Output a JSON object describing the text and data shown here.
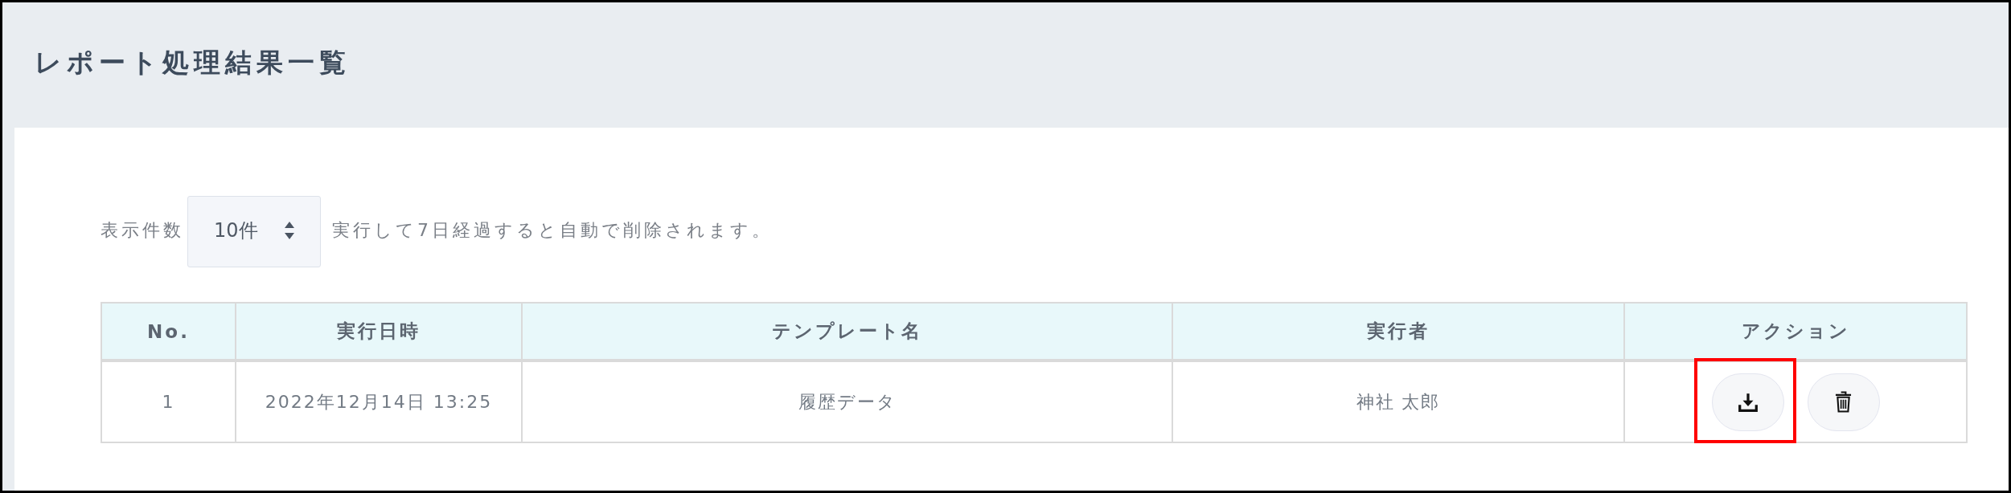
{
  "page": {
    "title": "レポート処理結果一覧"
  },
  "controls": {
    "page_size_label": "表示件数",
    "page_size": {
      "value": "10件"
    },
    "notice": "実行して7日経過すると自動で削除されます。"
  },
  "table": {
    "columns": [
      "No.",
      "実行日時",
      "テンプレート名",
      "実行者",
      "アクション"
    ],
    "rows": [
      {
        "cells": [
          "1",
          "2022年12月14日 13:25",
          "履歴データ",
          "神社 太郎"
        ],
        "actions": [
          {
            "kind": "download",
            "highlighted": true
          },
          {
            "kind": "delete",
            "highlighted": false
          }
        ]
      }
    ]
  }
}
